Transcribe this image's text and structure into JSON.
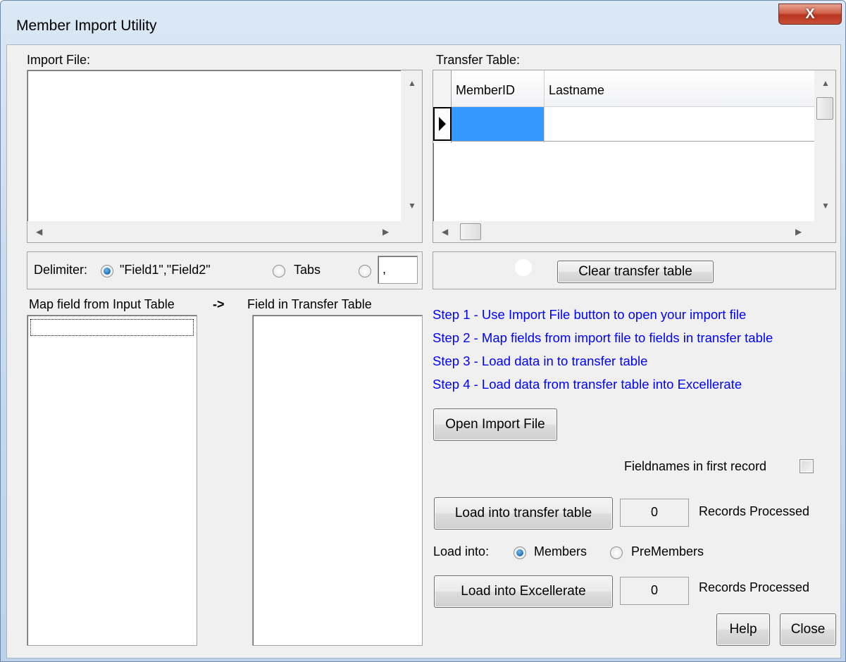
{
  "window": {
    "title": "Member Import Utility",
    "close_glyph": "X"
  },
  "import_file": {
    "label": "Import File:"
  },
  "transfer_table": {
    "label": "Transfer Table:",
    "columns": [
      "MemberID",
      "Lastname"
    ]
  },
  "delimiter": {
    "label": "Delimiter:",
    "options": [
      "\"Field1\",\"Field2\"",
      "Tabs",
      ""
    ],
    "custom_value": ",",
    "selected_index": 0
  },
  "mapping": {
    "from_label": "Map field from Input Table",
    "arrow": "->",
    "to_label": "Field in Transfer Table"
  },
  "buttons": {
    "clear_transfer": "Clear transfer table",
    "open_import": "Open Import File",
    "load_transfer": "Load into transfer table",
    "load_excellerate": "Load into Excellerate",
    "help": "Help",
    "close": "Close"
  },
  "steps": [
    "Step 1 - Use Import File button to open your import file",
    "Step 2 - Map fields from import file to fields in transfer table",
    "Step 3 - Load data in to transfer table",
    "Step 4 - Load data from transfer table into Excellerate"
  ],
  "fieldnames_first_record": {
    "label": "Fieldnames in first record",
    "checked": false
  },
  "transfer_count": {
    "value": "0",
    "label": "Records Processed"
  },
  "excellerate_count": {
    "value": "0",
    "label": "Records Processed"
  },
  "load_into": {
    "label": "Load into:",
    "options": [
      "Members",
      "PreMembers"
    ],
    "selected_index": 0
  },
  "colors": {
    "step_text": "#0000ff",
    "selected_cell": "#3399ff",
    "accent_radio": "#1d6fb3"
  }
}
